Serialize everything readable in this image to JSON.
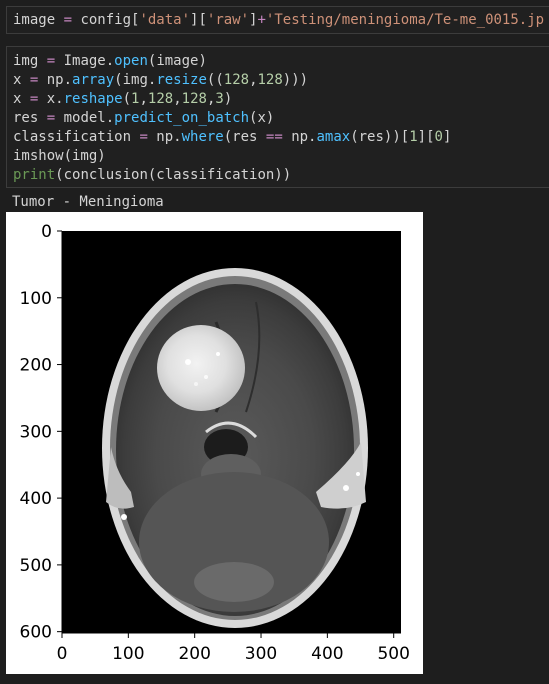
{
  "cell1": {
    "segments": [
      [
        "k",
        "image "
      ],
      [
        "op",
        "="
      ],
      [
        "k",
        " config["
      ],
      [
        "st",
        "'data'"
      ],
      [
        "k",
        "]["
      ],
      [
        "st",
        "'raw'"
      ],
      [
        "k",
        "]"
      ],
      [
        "op",
        "+"
      ],
      [
        "st",
        "'Testing/meningioma/Te-me_0015.jp"
      ]
    ]
  },
  "cell2": {
    "lines": [
      [
        [
          "k",
          "img "
        ],
        [
          "op",
          "="
        ],
        [
          "k",
          " Image."
        ],
        [
          "fn",
          "open"
        ],
        [
          "k",
          "(image)"
        ]
      ],
      [
        [
          "k",
          "x "
        ],
        [
          "op",
          "="
        ],
        [
          "k",
          " np."
        ],
        [
          "fn",
          "array"
        ],
        [
          "k",
          "(img."
        ],
        [
          "fn",
          "resize"
        ],
        [
          "k",
          "(("
        ],
        [
          "nm",
          "128"
        ],
        [
          "k",
          ","
        ],
        [
          "nm",
          "128"
        ],
        [
          "k",
          ")))"
        ]
      ],
      [
        [
          "k",
          "x "
        ],
        [
          "op",
          "="
        ],
        [
          "k",
          " x."
        ],
        [
          "fn",
          "reshape"
        ],
        [
          "k",
          "("
        ],
        [
          "nm",
          "1"
        ],
        [
          "k",
          ","
        ],
        [
          "nm",
          "128"
        ],
        [
          "k",
          ","
        ],
        [
          "nm",
          "128"
        ],
        [
          "k",
          ","
        ],
        [
          "nm",
          "3"
        ],
        [
          "k",
          ")"
        ]
      ],
      [
        [
          "k",
          "res "
        ],
        [
          "op",
          "="
        ],
        [
          "k",
          " model."
        ],
        [
          "fn",
          "predict_on_batch"
        ],
        [
          "k",
          "(x)"
        ]
      ],
      [
        [
          "k",
          "classification "
        ],
        [
          "op",
          "="
        ],
        [
          "k",
          " np."
        ],
        [
          "fn",
          "where"
        ],
        [
          "k",
          "(res "
        ],
        [
          "op",
          "=="
        ],
        [
          "k",
          " np."
        ],
        [
          "fn",
          "amax"
        ],
        [
          "k",
          "(res))["
        ],
        [
          "nm",
          "1"
        ],
        [
          "k",
          "]["
        ],
        [
          "nm",
          "0"
        ],
        [
          "k",
          "]"
        ]
      ],
      [
        [
          "k",
          "imshow(img)"
        ]
      ],
      [
        [
          "bi",
          "print"
        ],
        [
          "k",
          "(conclusion(classification))"
        ]
      ]
    ]
  },
  "output_text": "Tumor - Meningioma",
  "plot": {
    "image_label": "axial CT brain scan with meningioma",
    "x_ticks": [
      "0",
      "100",
      "200",
      "300",
      "400",
      "500"
    ],
    "y_ticks": [
      "0",
      "100",
      "200",
      "300",
      "400",
      "500",
      "600"
    ]
  }
}
